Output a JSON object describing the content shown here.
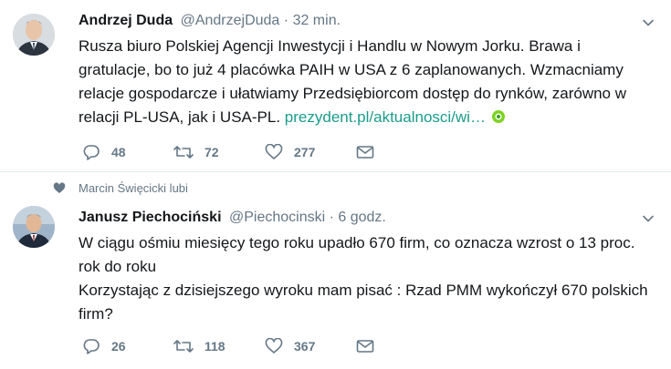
{
  "tweets": [
    {
      "name": "Andrzej Duda",
      "handle": "@AndrzejDuda",
      "separator": "·",
      "time": "32 min.",
      "text": "Rusza biuro Polskiej Agencji Inwestycji i Handlu w Nowym Jorku. Brawa i gratulacje, bo to już 4 placówka PAIH w USA z 6 zaplanowanych. Wzmacniamy relacje gospodarcze i ułatwiamy Przedsiębiorcom dostęp do rynków, zarówno w relacji PL-USA, jak i USA-PL. ",
      "link": "prezydent.pl/aktualnosci/wi…",
      "replies": "48",
      "retweets": "72",
      "likes": "277"
    },
    {
      "social_context": "Marcin Święcicki lubi",
      "name": "Janusz Piechociński",
      "handle": "@Piechocinski",
      "separator": "·",
      "time": "6 godz.",
      "text": "W ciągu ośmiu miesięcy tego roku upadło 670 firm, co oznacza wzrost o 13 proc. rok do roku\nKorzystając z dzisiejszego wyroku mam pisać : Rzad PMM wykończył 670 polskich firm?",
      "replies": "26",
      "retweets": "118",
      "likes": "367"
    }
  ],
  "icons": {
    "reply": "reply-icon",
    "retweet": "retweet-icon",
    "like": "heart-icon",
    "message": "envelope-icon",
    "caret": "chevron-down-icon",
    "social": "heart-icon",
    "link_preview": "link-preview-icon"
  },
  "colors": {
    "text": "#14171a",
    "muted": "#657786",
    "link": "#1a9c8a",
    "divider": "#e6ecf0"
  }
}
